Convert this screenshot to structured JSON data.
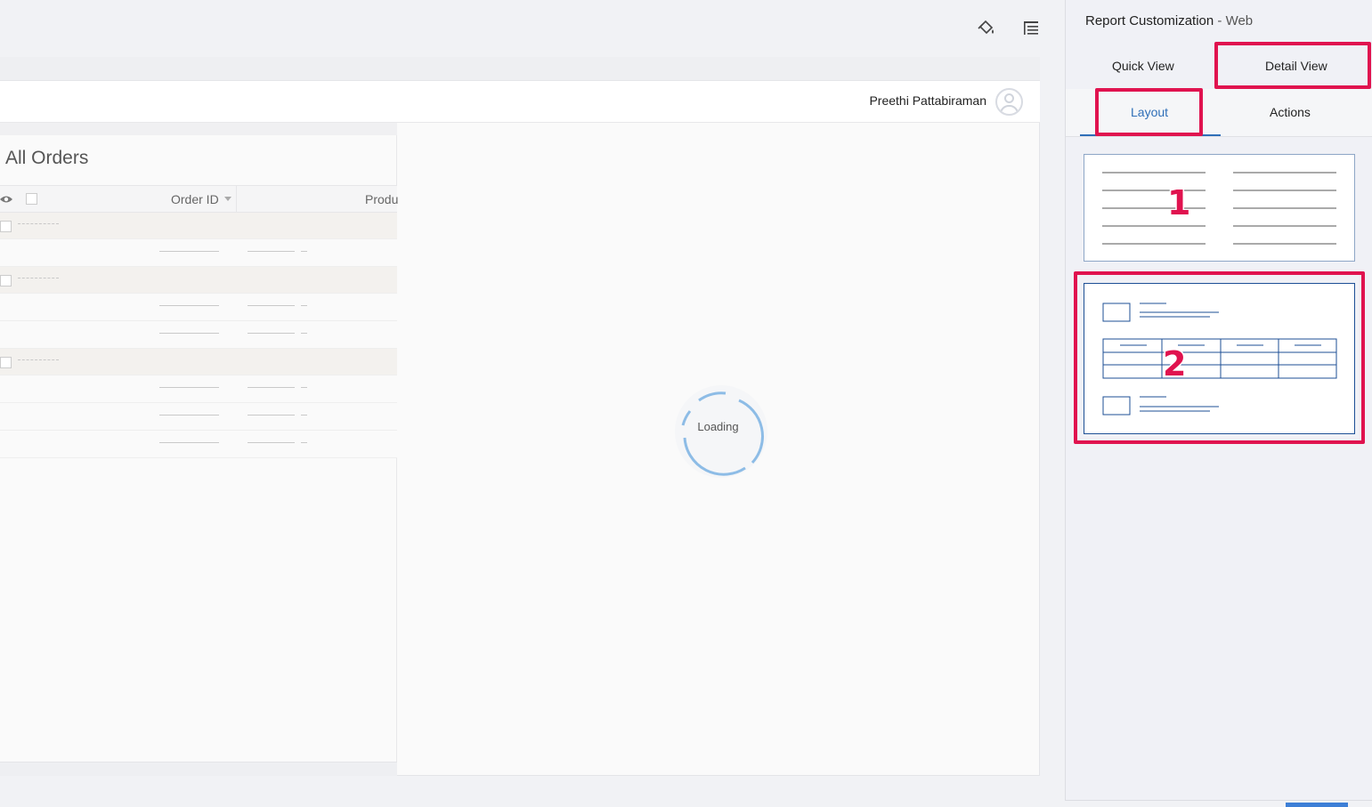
{
  "toolbar": {
    "icons": [
      "paint-bucket-icon",
      "column-settings-icon"
    ]
  },
  "user": {
    "name": "Preethi Pattabiraman"
  },
  "list": {
    "title": "All Orders",
    "columns": [
      "Order ID",
      "Produ"
    ]
  },
  "loading": {
    "text": "Loading"
  },
  "panel": {
    "title": "Report Customization",
    "title_separator": " - ",
    "title_sub": "Web",
    "tabs": [
      "Quick View",
      "Detail View"
    ],
    "active_tab": "Detail View",
    "subtabs": [
      "Layout",
      "Actions"
    ],
    "active_subtab": "Layout"
  },
  "annotations": {
    "badge_1": "1",
    "badge_2": "2"
  },
  "colors": {
    "accent": "#2f6fb8",
    "highlight": "#e0134f",
    "spinner": "#8dbce6"
  }
}
